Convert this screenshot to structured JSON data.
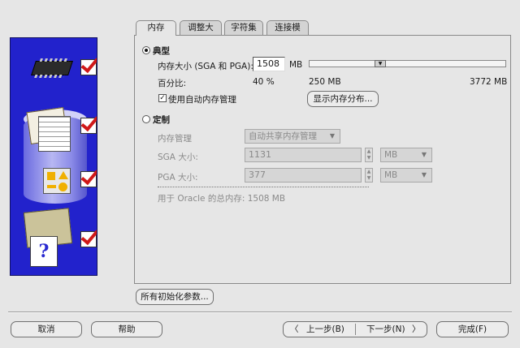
{
  "tabs": [
    {
      "label": "内存",
      "active": true
    },
    {
      "label": "调整大小",
      "active": false
    },
    {
      "label": "字符集",
      "active": false
    },
    {
      "label": "连接模式",
      "active": false
    }
  ],
  "typical": {
    "radio_label": "典型",
    "selected": true,
    "memory_size_label": "内存大小 (SGA 和 PGA):",
    "memory_size_value": "1508",
    "memory_size_unit": "MB",
    "slider_min_label": "250 MB",
    "slider_max_label": "3772 MB",
    "percentage_label": "百分比:",
    "percentage_value": "40 %",
    "auto_memory_label": "使用自动内存管理",
    "auto_memory_checked": true,
    "show_distribution_button": "显示内存分布..."
  },
  "custom": {
    "radio_label": "定制",
    "selected": false,
    "memory_mgmt_label": "内存管理",
    "memory_mgmt_value": "自动共享内存管理",
    "sga_label": "SGA 大小:",
    "sga_value": "1131",
    "sga_unit": "MB",
    "pga_label": "PGA 大小:",
    "pga_value": "377",
    "pga_unit": "MB",
    "total_memory_text": "用于 Oracle 的总内存: 1508 MB"
  },
  "all_init_params_button": "所有初始化参数...",
  "footer": {
    "cancel": "取消",
    "help": "帮助",
    "back": "上一步(B)",
    "next": "下一步(N)",
    "finish": "完成(F)"
  },
  "colors": {
    "side_panel_bg": "#2222cc",
    "window_bg": "#e6e6e6",
    "check_red": "#d01818"
  }
}
